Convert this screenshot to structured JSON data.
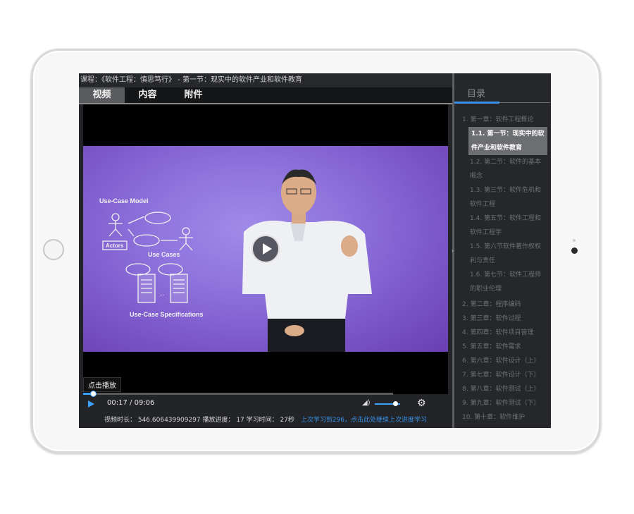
{
  "breadcrumb": "课程：《软件工程：慎思笃行》 - 第一节：现实中的软件产业和软件教育",
  "tabs": [
    {
      "label": "视频",
      "active": true
    },
    {
      "label": "内容",
      "active": false
    },
    {
      "label": "附件",
      "active": false
    }
  ],
  "video": {
    "slide": {
      "model_title": "Use-Case Model",
      "actors_label": "Actors",
      "use_cases_label": "Use Cases",
      "specs_label": "Use-Case Specifications"
    },
    "play_tooltip": "点击播放",
    "progress_fraction": 0.03
  },
  "controls": {
    "current_time": "00:17",
    "separator": "/",
    "total_time": "09:06",
    "volume_fraction": 0.8
  },
  "stats": {
    "text": "视频时长： 546.606439909297 播放进度： 17 学习时间： 27秒",
    "resume_link": "上次学习到296，点击此处继续上次进度学习"
  },
  "sidebar": {
    "title": "目录",
    "chapters": [
      {
        "label": "1. 第一章：软件工程概论"
      },
      {
        "label": "2. 第二章：程序编码"
      },
      {
        "label": "3. 第三章：软件过程"
      },
      {
        "label": "4. 第四章：软件项目管理"
      },
      {
        "label": "5. 第五章：软件需求"
      },
      {
        "label": "6. 第六章：软件设计（上）"
      },
      {
        "label": "7. 第七章：软件设计（下）"
      },
      {
        "label": "8. 第八章：软件测试（上）"
      },
      {
        "label": "9. 第九章：软件测试（下）"
      },
      {
        "label": "10. 第十章：软件维护"
      }
    ],
    "sections": [
      {
        "line1": "1.1. 第一节：现实中的软",
        "line2": "件产业和软件教育",
        "active": true
      },
      {
        "line1": "1.2. 第二节：软件的基本",
        "line2": "概念",
        "active": false
      },
      {
        "line1": "1.3. 第三节：软件危机和",
        "line2": "软件工程",
        "active": false
      },
      {
        "line1": "1.4. 第五节：软件工程和",
        "line2": "软件工程学",
        "active": false
      },
      {
        "line1": "1.5. 第六节软件著作权权",
        "line2": "利与责任",
        "active": false
      },
      {
        "line1": "1.6. 第七节：软件工程师",
        "line2": "的职业伦理",
        "active": false
      }
    ]
  },
  "colors": {
    "accent": "#3a8fe6",
    "screen_bg": "#222427",
    "sidebar_bg": "#25272a",
    "active_section_bg": "#6c6e72"
  },
  "icons": {
    "play": "play-icon",
    "volume": "volume-icon",
    "settings": "gear-icon"
  }
}
